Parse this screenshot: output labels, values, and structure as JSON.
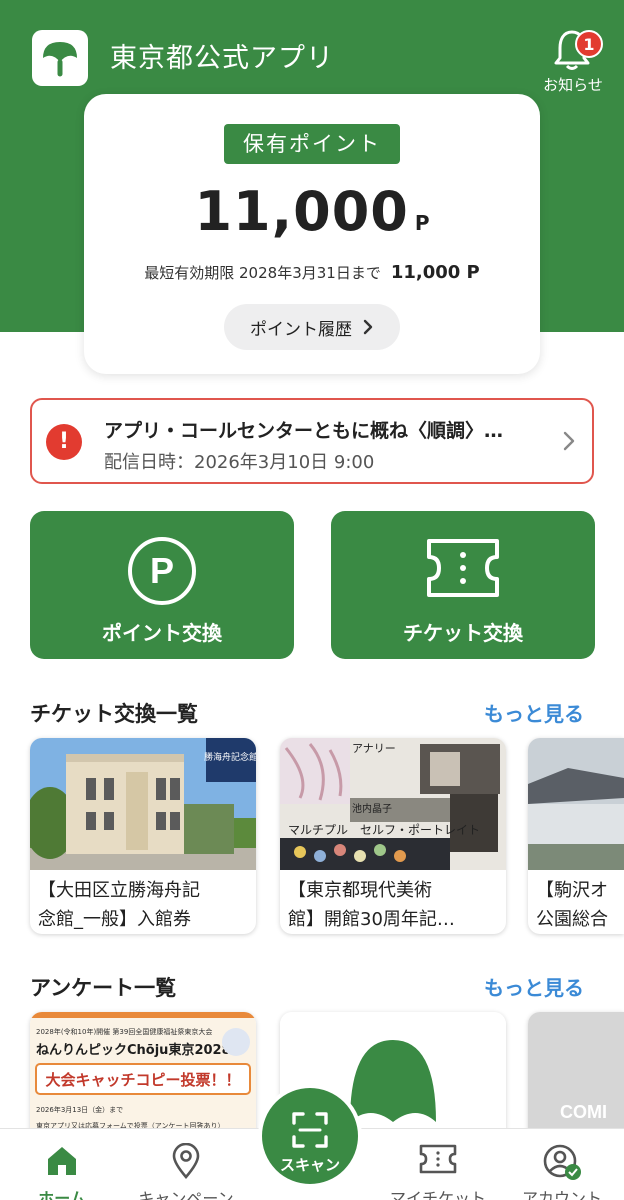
{
  "header": {
    "app_title": "東京都公式アプリ",
    "notification_label": "お知らせ",
    "notification_count": "1"
  },
  "points": {
    "tag": "保有ポイント",
    "value": "11,000",
    "unit": "P",
    "expiry_label": "最短有効期限 2028年3月31日まで",
    "expiry_amount": "11,000 P",
    "history_button": "ポイント履歴"
  },
  "notice": {
    "title": "アプリ・コールセンターともに概ね〈順調〉…",
    "date": "配信日時：2026年3月10日 9:00"
  },
  "actions": {
    "point_exchange": "ポイント交換",
    "ticket_exchange": "チケット交換"
  },
  "tickets": {
    "title": "チケット交換一覧",
    "more": "もっと見る",
    "items": [
      {
        "line1": "【大田区立勝海舟記",
        "line2": "念館_一般】入館券"
      },
      {
        "line1": "【東京都現代美術",
        "line2": "館】開館30周年記…"
      },
      {
        "line1": "【駒沢オ",
        "line2": "公園総合"
      }
    ],
    "images": {
      "museum_sign": "勝海舟記念館",
      "mot_line1": "マルチプル",
      "mot_line2": "セルフ・ポートレイト",
      "mot_side": "池内晶子",
      "mot_top": "アナリー"
    }
  },
  "surveys": {
    "title": "アンケート一覧",
    "more": "もっと見る",
    "banner_line1": "2028年(令和10年)開催 第39回全国健康福祉祭東京大会",
    "banner_line2": "ねんりんピックChōju東京2028",
    "banner_line3": "大会キャッチコピー投票！！",
    "banner_line4": "2026年3月13日（金）まで",
    "banner_line5": "東京アプリ又は応募フォームで投票（アンケート回答あり）",
    "coming": "COMI"
  },
  "tabbar": {
    "home": "ホーム",
    "campaign": "キャンペーン",
    "scan": "スキャン",
    "my_ticket": "マイチケット",
    "account": "アカウント"
  },
  "colors": {
    "brand_green": "#3a8a44",
    "alert_red": "#e23b30",
    "link_blue": "#3b8ad6"
  }
}
